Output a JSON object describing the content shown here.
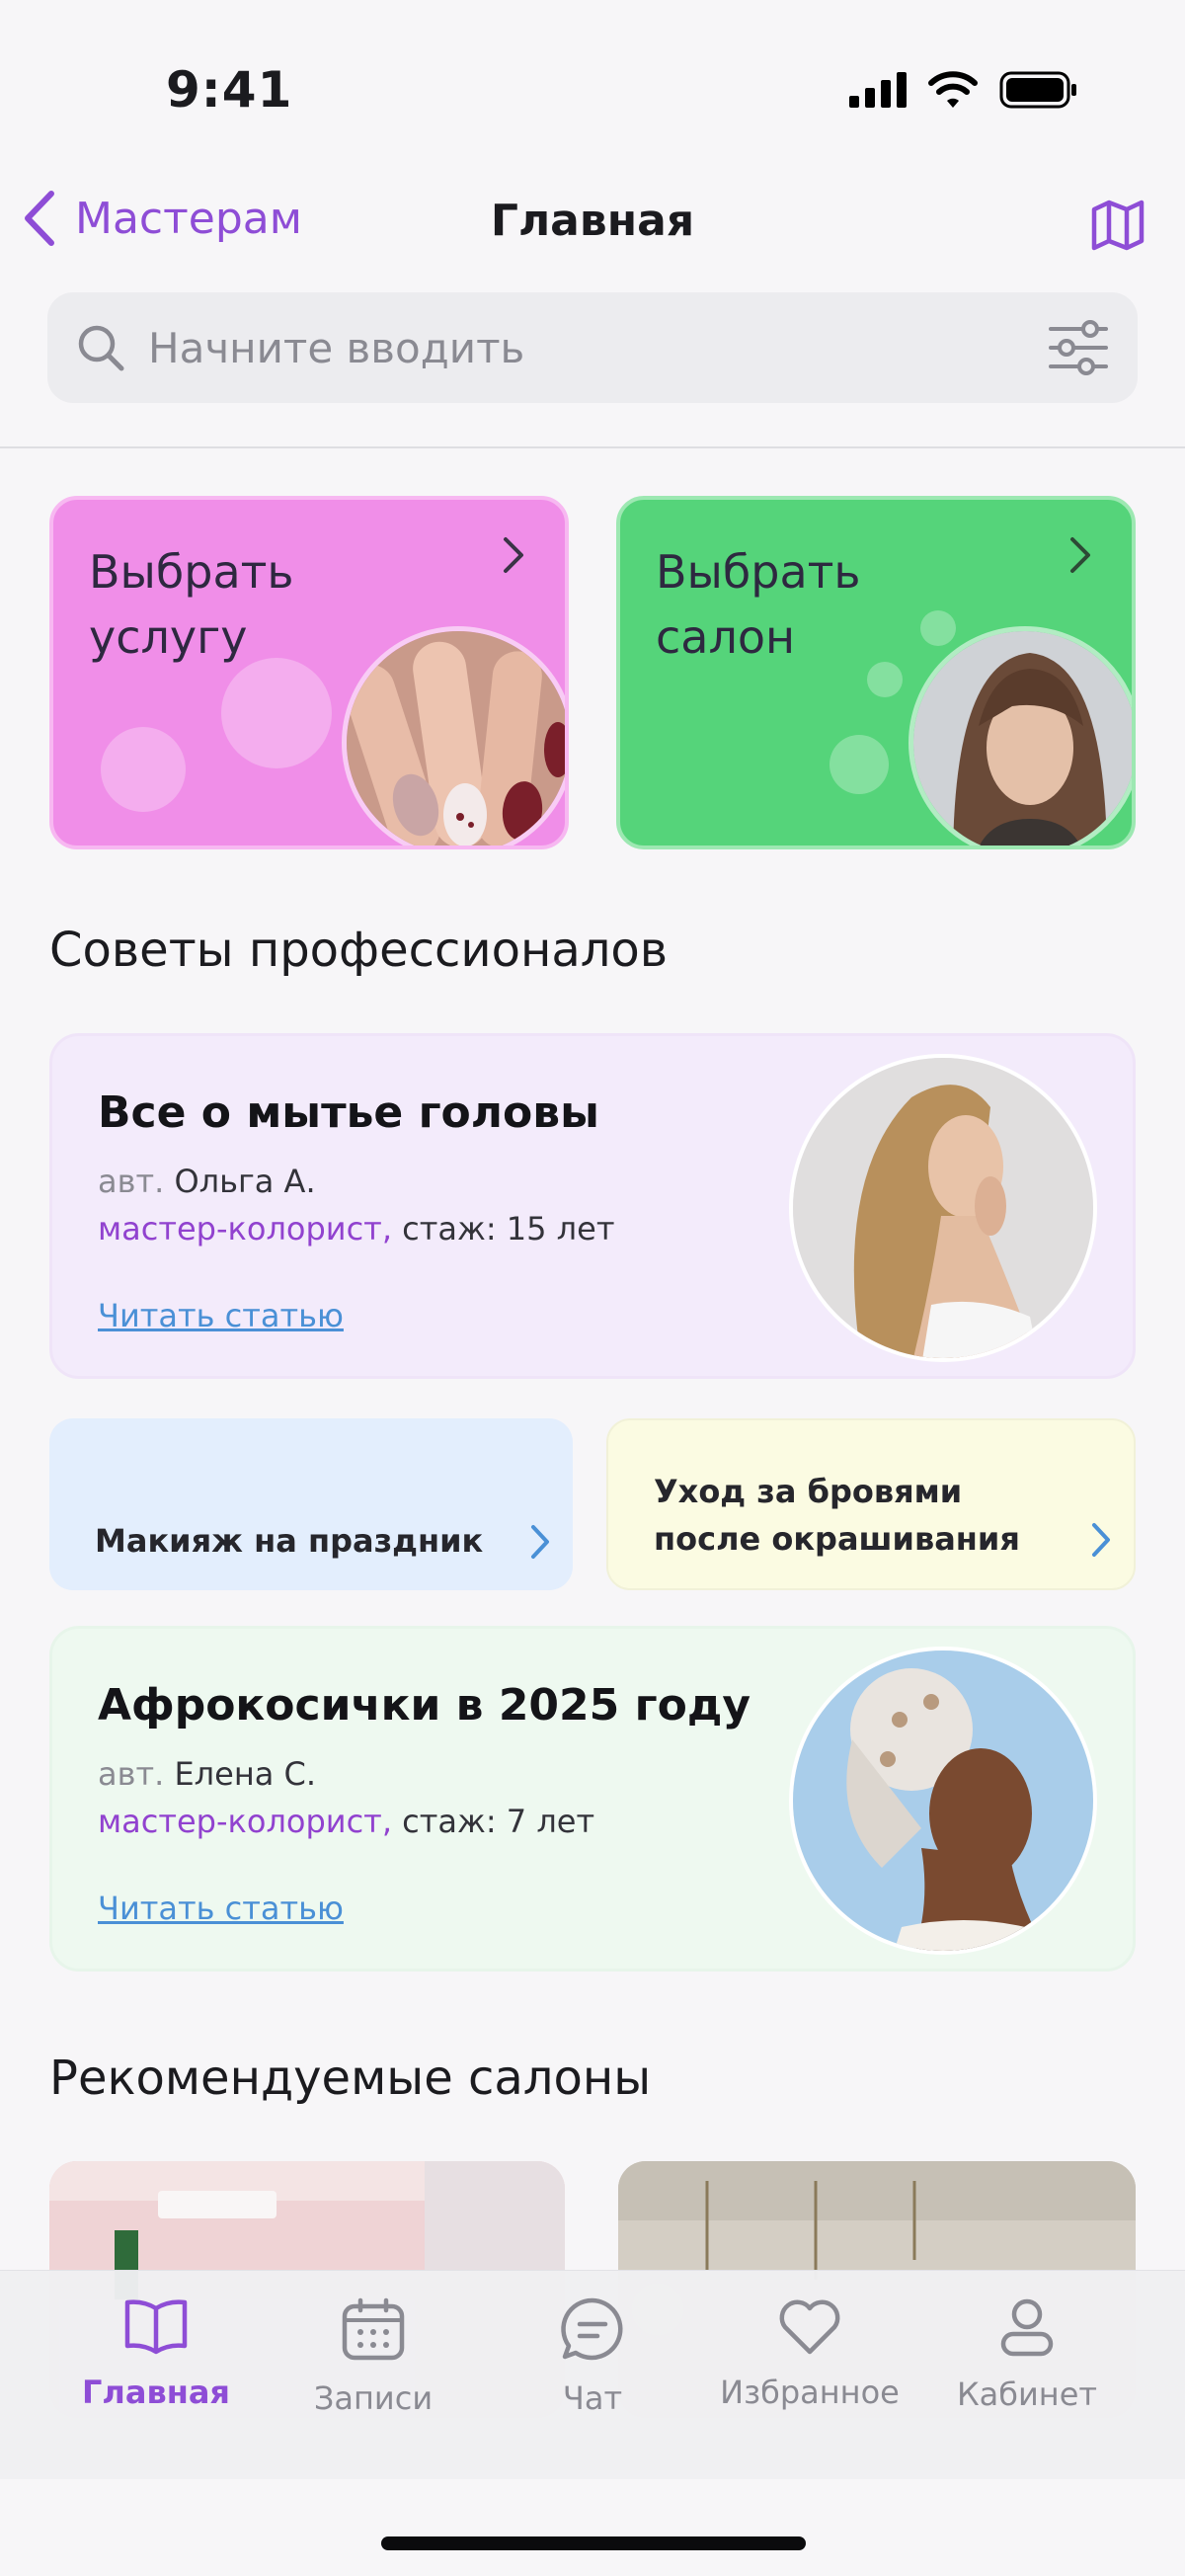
{
  "status": {
    "time": "9:41"
  },
  "nav": {
    "back_label": "Мастерам",
    "title": "Главная"
  },
  "search": {
    "placeholder": "Начните вводить"
  },
  "quick": {
    "service_label": "Выбрать услугу",
    "salon_label": "Выбрать салон"
  },
  "tips": {
    "title": "Советы профессионалов",
    "articles": [
      {
        "title": "Все о мытье головы",
        "author_prefix": "авт.",
        "author": "Ольга А.",
        "role": "мастер-колорист,",
        "experience": "стаж: 15 лет",
        "link": "Читать статью"
      },
      {
        "title": "Афрокосички в 2025 году",
        "author_prefix": "авт.",
        "author": "Елена С.",
        "role": "мастер-колорист,",
        "experience": "стаж: 7 лет",
        "link": "Читать статью"
      }
    ],
    "small": [
      {
        "label": "Макияж на праздник"
      },
      {
        "line1": "Уход за бровями",
        "line2": "после окрашивания"
      }
    ]
  },
  "recommended": {
    "title": "Рекомендуемые салоны"
  },
  "tabs": [
    {
      "label": "Главная",
      "icon": "book-icon",
      "active": true
    },
    {
      "label": "Записи",
      "icon": "calendar-icon",
      "active": false
    },
    {
      "label": "Чат",
      "icon": "chat-icon",
      "active": false
    },
    {
      "label": "Избранное",
      "icon": "heart-icon",
      "active": false
    },
    {
      "label": "Кабинет",
      "icon": "profile-icon",
      "active": false
    }
  ],
  "colors": {
    "accent": "#8e4dd6",
    "service_card": "#f08ee8",
    "salon_card": "#55d47a",
    "link": "#4a90d6"
  }
}
